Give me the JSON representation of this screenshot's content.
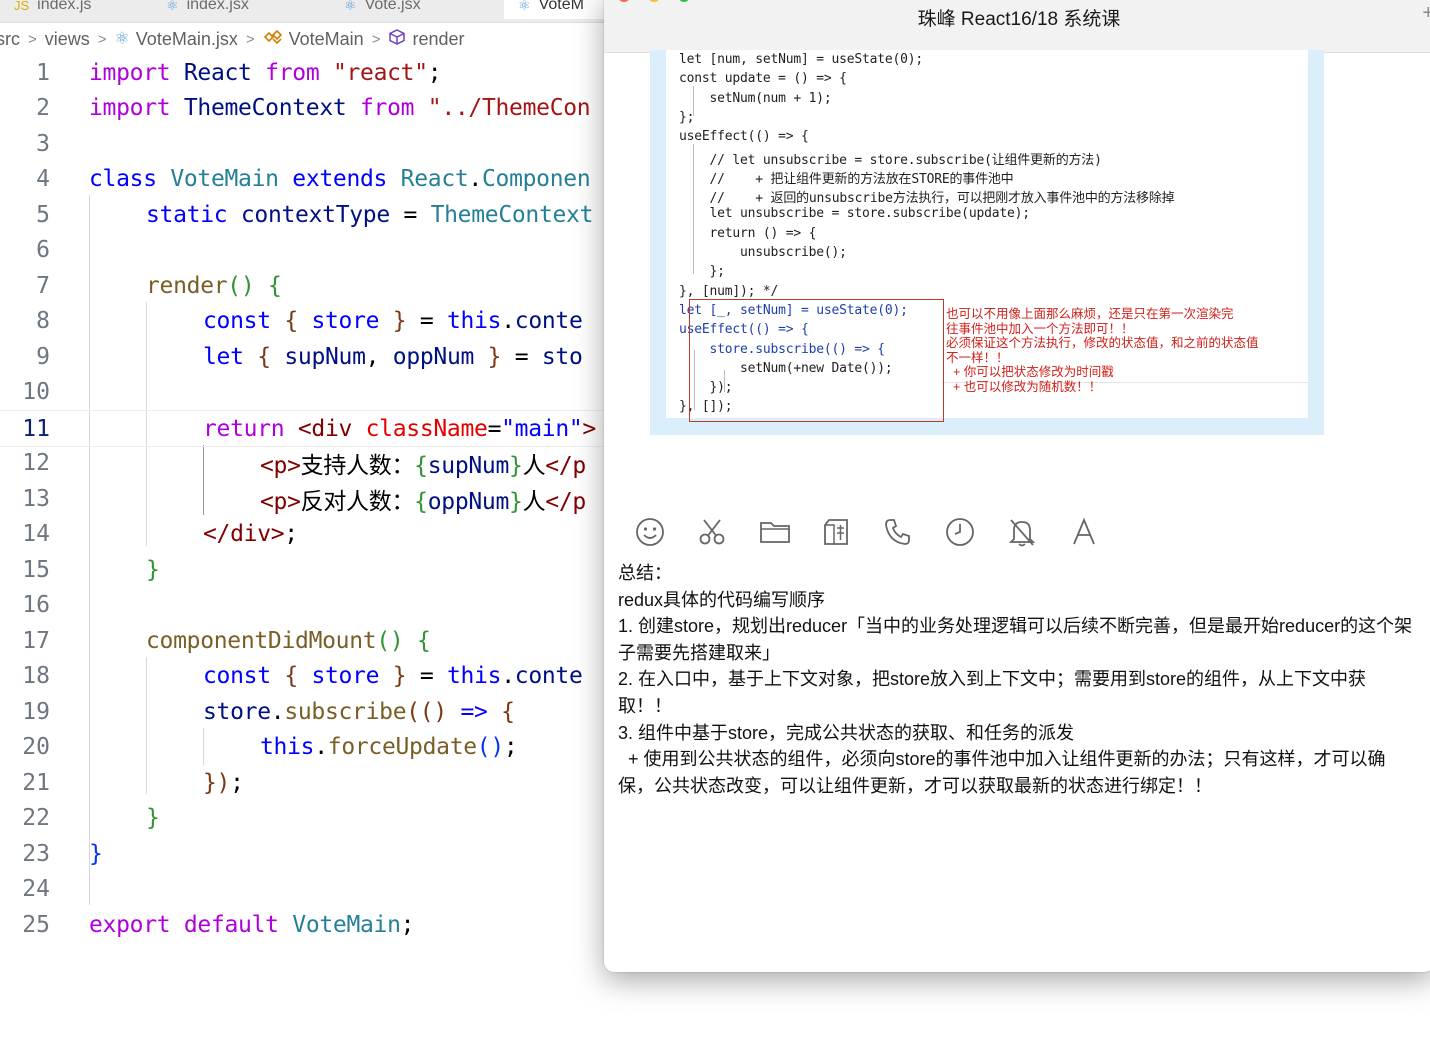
{
  "editor": {
    "tabs": [
      {
        "label": "index.js",
        "icon": "js-file-icon"
      },
      {
        "label": "index.jsx",
        "icon": "react-file-icon"
      },
      {
        "label": "Vote.jsx",
        "icon": "react-file-icon"
      },
      {
        "label": "VoteM",
        "icon": "react-file-icon"
      }
    ],
    "breadcrumb": {
      "segments": [
        "src",
        "views",
        "VoteMain.jsx",
        "VoteMain",
        "render"
      ]
    },
    "current_line": 11,
    "lines": [
      {
        "n": "1"
      },
      {
        "n": "2"
      },
      {
        "n": "3"
      },
      {
        "n": "4"
      },
      {
        "n": "5"
      },
      {
        "n": "6"
      },
      {
        "n": "7"
      },
      {
        "n": "8"
      },
      {
        "n": "9"
      },
      {
        "n": "10"
      },
      {
        "n": "11"
      },
      {
        "n": "12"
      },
      {
        "n": "13"
      },
      {
        "n": "14"
      },
      {
        "n": "15"
      },
      {
        "n": "16"
      },
      {
        "n": "17"
      },
      {
        "n": "18"
      },
      {
        "n": "19"
      },
      {
        "n": "20"
      },
      {
        "n": "21"
      },
      {
        "n": "22"
      },
      {
        "n": "23"
      },
      {
        "n": "24"
      },
      {
        "n": "25"
      }
    ],
    "code": {
      "l1": [
        "import",
        "React",
        "from",
        "\"react\"",
        ";"
      ],
      "l2": [
        "import",
        "ThemeContext",
        "from",
        "\"../ThemeCon"
      ],
      "l4": [
        "class",
        "VoteMain",
        "extends",
        "React",
        ".",
        "Componen"
      ],
      "l5": [
        "static",
        "contextType",
        "=",
        "ThemeContext"
      ],
      "l7": [
        "render",
        "()",
        "{"
      ],
      "l8": [
        "const",
        "{",
        "store",
        "}",
        "=",
        "this",
        ".",
        "conte"
      ],
      "l9": [
        "let",
        "{",
        "supNum",
        ",",
        "oppNum",
        "}",
        "=",
        "sto"
      ],
      "l11": [
        "return",
        "<div",
        "className",
        "=",
        "\"main\"",
        ">"
      ],
      "l12": [
        "<p>",
        "支持人数：",
        "{",
        "supNum",
        "}",
        "人",
        "</p"
      ],
      "l13": [
        "<p>",
        "反对人数：",
        "{",
        "oppNum",
        "}",
        "人",
        "</p"
      ],
      "l14": [
        "</div>",
        ";"
      ],
      "l15": [
        "}"
      ],
      "l17": [
        "componentDidMount",
        "()",
        "{"
      ],
      "l18": [
        "const",
        "{",
        "store",
        "}",
        "=",
        "this",
        ".",
        "conte"
      ],
      "l19": [
        "store",
        ".",
        "subscribe",
        "((",
        ")",
        "=>",
        "{"
      ],
      "l20": [
        "this",
        ".",
        "forceUpdate",
        "()",
        ";"
      ],
      "l21": [
        "})",
        ";"
      ],
      "l22": [
        "}"
      ],
      "l23": [
        "}"
      ],
      "l25": [
        "export",
        "default",
        "VoteMain",
        ";"
      ]
    }
  },
  "chat": {
    "title": "珠峰 React16/18 系统课",
    "plus": "+",
    "screenshot": {
      "lines": [
        "let [num, setNum] = useState(0);",
        "const update = () => {",
        "    setNum(num + 1);",
        "};",
        "useEffect(() => {",
        "    // let unsubscribe = store.subscribe(让组件更新的方法)",
        "    //    + 把让组件更新的方法放在STORE的事件池中",
        "    //    + 返回的unsubscribe方法执行，可以把刚才放入事件池中的方法移除掉",
        "    let unsubscribe = store.subscribe(update);",
        "    return () => {",
        "        unsubscribe();",
        "    };",
        "}, [num]); */",
        "let [_, setNum] = useState(0);",
        "useEffect(() => {",
        "    store.subscribe(() => {",
        "        setNum(+new Date());",
        "    });",
        "}, []);"
      ],
      "note": [
        "也可以不用像上面那么麻烦，还是只在第一次渲染完",
        "往事件池中加入一个方法即可！！",
        "必须保证这个方法执行，修改的状态值，和之前的状态值",
        "不一样！！",
        "  + 你可以把状态修改为时间戳",
        "  + 也可以修改为随机数！！"
      ]
    },
    "toolbar": [
      {
        "name": "emoji-icon"
      },
      {
        "name": "scissors-icon"
      },
      {
        "name": "folder-icon"
      },
      {
        "name": "red-packet-icon"
      },
      {
        "name": "phone-icon"
      },
      {
        "name": "clock-icon"
      },
      {
        "name": "mute-bell-icon"
      },
      {
        "name": "font-icon"
      }
    ],
    "message": [
      "总结：",
      "redux具体的代码编写顺序",
      "1. 创建store，规划出reducer「当中的业务处理逻辑可以后续不断完善，但是最开始reducer的这个架子需要先搭建取来」",
      "2. 在入口中，基于上下文对象，把store放入到上下文中；需要用到store的组件，从上下文中获取！！",
      "3. 组件中基于store，完成公共状态的获取、和任务的派发",
      "  + 使用到公共状态的组件，必须向store的事件池中加入让组件更新的办法；只有这样，才可以确保，公共状态改变，可以让组件更新，才可以获取最新的状态进行绑定！！"
    ],
    "colors": {
      "window_bg": "#ffffff",
      "titlebar_bg": "#f2f2f2",
      "screenshot_border": "#dbeefb",
      "note_red": "#d0201a"
    }
  }
}
